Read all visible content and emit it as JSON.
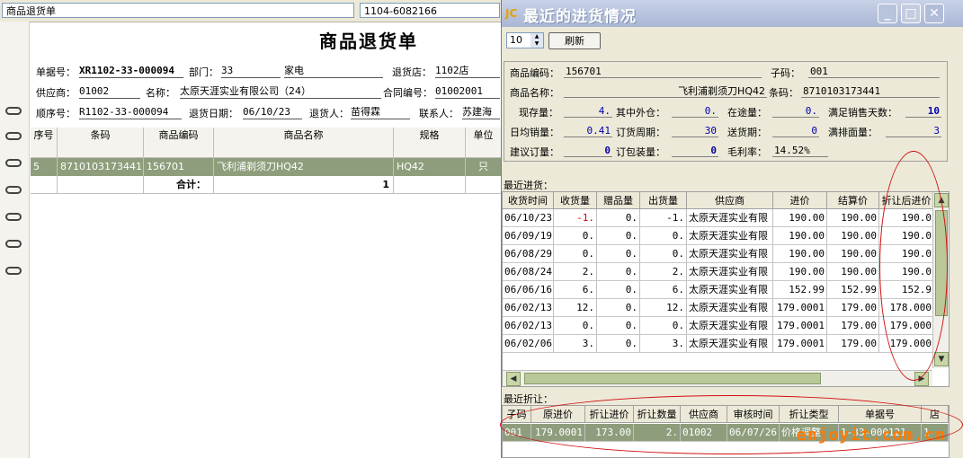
{
  "tabs": {
    "doc_tab": "商品退货单",
    "doc_no_tab": "1104-6082166"
  },
  "form": {
    "title": "商品退货单",
    "row1": {
      "doc_no_label": "单据号：",
      "doc_no": "XR1102-33-000094",
      "dept_label": "部门：",
      "dept_code": "33",
      "dept_name": "家电",
      "store_label": "退货店：",
      "store": "1102店"
    },
    "row2": {
      "supplier_label": "供应商：",
      "supplier_code": "01002",
      "name_label": "名称：",
      "supplier_name": "太原天涯实业有限公司（24）",
      "contract_label": "合同编号：",
      "contract_no": "01002001"
    },
    "row3": {
      "seq_label": "顺序号：",
      "seq_no": "R1102-33-000094",
      "date_label": "退货日期：",
      "date": "06/10/23",
      "returner_label": "退货人：",
      "returner": "苗得霖",
      "contact_label": "联系人：",
      "contact": "苏建海"
    },
    "grid": {
      "headers": [
        "序号",
        "条码",
        "商品编码",
        "商品名称",
        "规格",
        "单位"
      ],
      "row": [
        "5",
        "8710103173441",
        "156701",
        "飞利浦剃须刀HQ42",
        "HQ42",
        "只"
      ],
      "total_label": "合计：",
      "total_value": "1"
    }
  },
  "dialog": {
    "title": "最近的进货情况",
    "count_value": "10",
    "refresh_label": "刷新",
    "info": {
      "code_label": "商品编码：",
      "code": "156701",
      "subcode_label": "子码：",
      "subcode": "001",
      "name_label": "商品名称：",
      "name": "飞利浦剃须刀HQ42",
      "barcode_label": "条码：",
      "barcode": "8710103173441",
      "stock_label": "现存量：",
      "stock": "4.",
      "incl_label": "其中外仓：",
      "incl": "0.",
      "transit_label": "在途量：",
      "transit": "0.",
      "days_label": "满足销售天数：",
      "days": "10",
      "daily_label": "日均销量：",
      "daily": "0.41",
      "cycle_label": "订货周期：",
      "cycle": "30",
      "lead_label": "送货期：",
      "lead": "0",
      "face_label": "满排面量：",
      "face": "3",
      "suggest_label": "建议订量：",
      "suggest": "0",
      "pack_label": "订包装量：",
      "pack": "0",
      "margin_label": "毛利率：",
      "margin": "14.52%"
    },
    "purchases_label": "最近进货：",
    "purchases": {
      "headers": [
        "收货时间",
        "收货量",
        "赠品量",
        "出货量",
        "供应商",
        "进价",
        "结算价",
        "折让后进价"
      ],
      "rows": [
        [
          "06/10/23",
          "-1.",
          "0.",
          "-1.",
          "太原天涯实业有限",
          "190.00",
          "190.00",
          "190.0"
        ],
        [
          "06/09/19",
          "0.",
          "0.",
          "0.",
          "太原天涯实业有限",
          "190.00",
          "190.00",
          "190.0"
        ],
        [
          "06/08/29",
          "0.",
          "0.",
          "0.",
          "太原天涯实业有限",
          "190.00",
          "190.00",
          "190.0"
        ],
        [
          "06/08/24",
          "2.",
          "0.",
          "2.",
          "太原天涯实业有限",
          "190.00",
          "190.00",
          "190.0"
        ],
        [
          "06/06/16",
          "6.",
          "0.",
          "6.",
          "太原天涯实业有限",
          "152.99",
          "152.99",
          "152.9"
        ],
        [
          "06/02/13",
          "12.",
          "0.",
          "12.",
          "太原天涯实业有限",
          "179.0001",
          "179.00",
          "178.000"
        ],
        [
          "06/02/13",
          "0.",
          "0.",
          "0.",
          "太原天涯实业有限",
          "179.0001",
          "179.00",
          "179.000"
        ],
        [
          "06/02/06",
          "3.",
          "0.",
          "3.",
          "太原天涯实业有限",
          "179.0001",
          "179.00",
          "179.000"
        ]
      ]
    },
    "discounts_label": "最近折让：",
    "discounts": {
      "headers": [
        "子码",
        "原进价",
        "折让进价",
        "折让数量",
        "供应商",
        "审核时间",
        "折让类型",
        "单据号",
        "店"
      ],
      "row": [
        "001",
        "179.0001",
        "173.00",
        "2.",
        "01002",
        "06/07/26",
        "价格调整",
        "1-33-000121",
        "1"
      ]
    }
  },
  "watermark": "enjoyit.com.cn",
  "colors": {
    "selected_row": "#8e9e7c",
    "title_gradient": "#a9b6d4",
    "annotation_red": "#d01010",
    "negative": "#d00000"
  }
}
